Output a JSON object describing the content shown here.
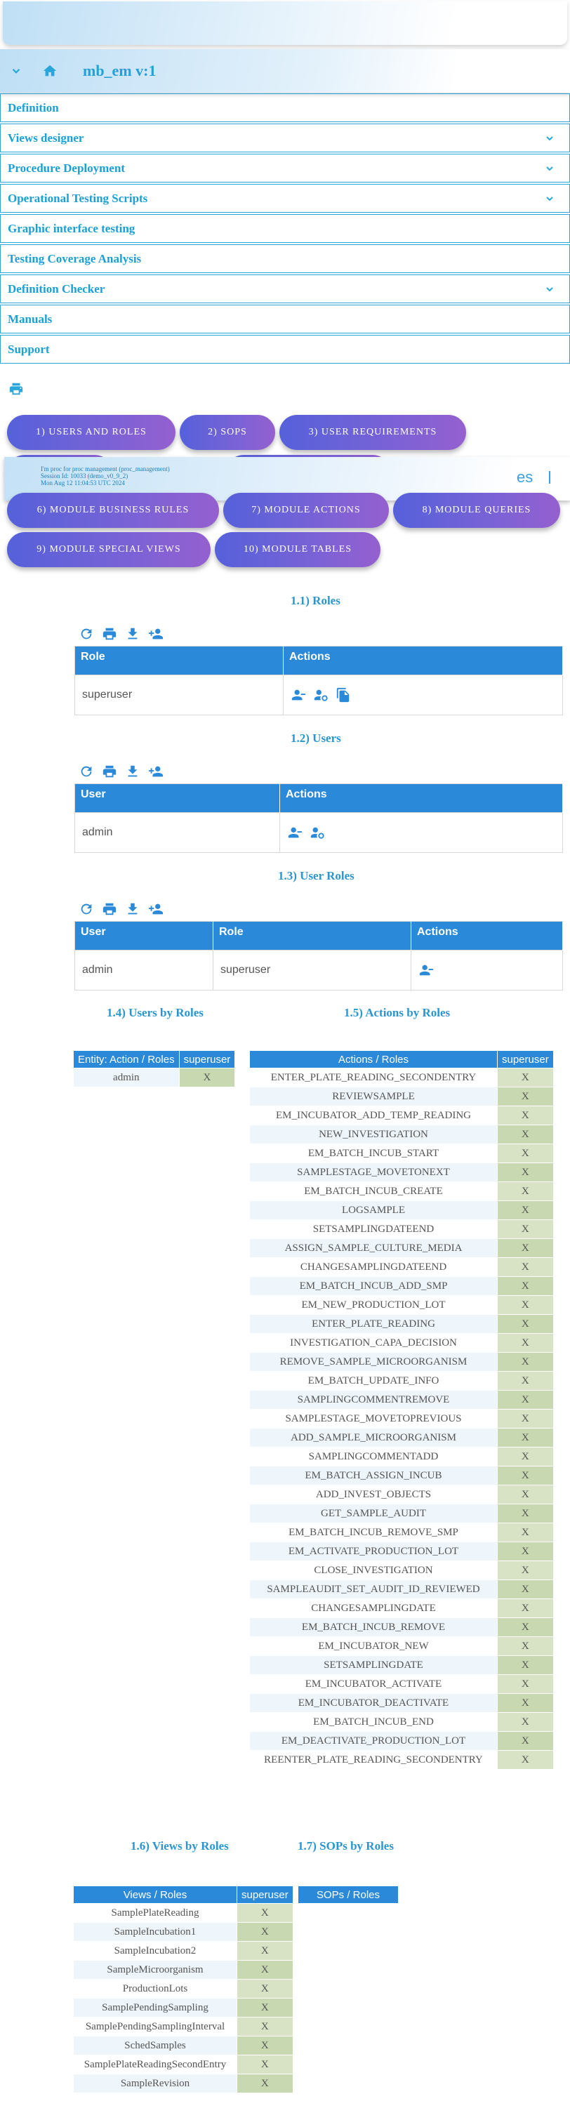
{
  "header": {
    "app_title": "mb_em v:1"
  },
  "menu": [
    {
      "label": "Definition",
      "chevron": false
    },
    {
      "label": "Views designer",
      "chevron": true
    },
    {
      "label": "Procedure Deployment",
      "chevron": true
    },
    {
      "label": "Operational Testing Scripts",
      "chevron": true
    },
    {
      "label": "Graphic interface testing",
      "chevron": false
    },
    {
      "label": "Testing Coverage Analysis",
      "chevron": false
    },
    {
      "label": "Definition Checker",
      "chevron": true
    },
    {
      "label": "Manuals",
      "chevron": false
    },
    {
      "label": "Support",
      "chevron": false
    }
  ],
  "tabs": [
    "1) USERS AND ROLES",
    "2) SOPS",
    "3) USER REQUIREMENTS",
    "6) MODULE BUSINESS RULES",
    "7) MODULE ACTIONS",
    "8) MODULE QUERIES",
    "9) MODULE SPECIAL VIEWS",
    "10) MODULE TABLES"
  ],
  "session": {
    "line1": "I'm proc for proc management (proc_management)",
    "line2": "Session Id: 10033 (demo_v0_9_2)",
    "line3": "Mon Aug 12 11:04:53 UTC 2024",
    "language": "es"
  },
  "sections": {
    "roles": "1.1) Roles",
    "users": "1.2) Users",
    "user_roles": "1.3) User Roles",
    "users_by_roles": "1.4) Users by Roles",
    "actions_by_roles": "1.5) Actions by Roles",
    "views_by_roles": "1.6) Views by Roles",
    "sops_by_roles": "1.7) SOPs by Roles"
  },
  "roles_table": {
    "headers": [
      "Role",
      "Actions"
    ],
    "rows": [
      [
        "superuser"
      ]
    ]
  },
  "users_table": {
    "headers": [
      "User",
      "Actions"
    ],
    "rows": [
      [
        "admin"
      ]
    ]
  },
  "user_roles_table": {
    "headers": [
      "User",
      "Role",
      "Actions"
    ],
    "rows": [
      [
        "admin",
        "superuser"
      ]
    ]
  },
  "users_by_roles": {
    "headers": [
      "Entity: Action / Roles",
      "superuser"
    ],
    "rows": [
      [
        "admin",
        "X"
      ]
    ]
  },
  "actions_by_roles": {
    "headers": [
      "Actions / Roles",
      "superuser"
    ],
    "rows": [
      "ENTER_PLATE_READING_SECONDENTRY",
      "REVIEWSAMPLE",
      "EM_INCUBATOR_ADD_TEMP_READING",
      "NEW_INVESTIGATION",
      "EM_BATCH_INCUB_START",
      "SAMPLESTAGE_MOVETONEXT",
      "EM_BATCH_INCUB_CREATE",
      "LOGSAMPLE",
      "SETSAMPLINGDATEEND",
      "ASSIGN_SAMPLE_CULTURE_MEDIA",
      "CHANGESAMPLINGDATEEND",
      "EM_BATCH_INCUB_ADD_SMP",
      "EM_NEW_PRODUCTION_LOT",
      "ENTER_PLATE_READING",
      "INVESTIGATION_CAPA_DECISION",
      "REMOVE_SAMPLE_MICROORGANISM",
      "EM_BATCH_UPDATE_INFO",
      "SAMPLINGCOMMENTREMOVE",
      "SAMPLESTAGE_MOVETOPREVIOUS",
      "ADD_SAMPLE_MICROORGANISM",
      "SAMPLINGCOMMENTADD",
      "EM_BATCH_ASSIGN_INCUB",
      "ADD_INVEST_OBJECTS",
      "GET_SAMPLE_AUDIT",
      "EM_BATCH_INCUB_REMOVE_SMP",
      "EM_ACTIVATE_PRODUCTION_LOT",
      "CLOSE_INVESTIGATION",
      "SAMPLEAUDIT_SET_AUDIT_ID_REVIEWED",
      "CHANGESAMPLINGDATE",
      "EM_BATCH_INCUB_REMOVE",
      "EM_INCUBATOR_NEW",
      "SETSAMPLINGDATE",
      "EM_INCUBATOR_ACTIVATE",
      "EM_INCUBATOR_DEACTIVATE",
      "EM_BATCH_INCUB_END",
      "EM_DEACTIVATE_PRODUCTION_LOT",
      "REENTER_PLATE_READING_SECONDENTRY"
    ],
    "mark": "X"
  },
  "views_by_roles": {
    "headers": [
      "Views / Roles",
      "superuser"
    ],
    "rows": [
      "SamplePlateReading",
      "SampleIncubation1",
      "SampleIncubation2",
      "SampleMicroorganism",
      "ProductionLots",
      "SamplePendingSampling",
      "SamplePendingSamplingInterval",
      "SchedSamples",
      "SamplePlateReadingSecondEntry",
      "SampleRevision"
    ],
    "mark": "X"
  },
  "sops_by_roles": {
    "headers": [
      "SOPs / Roles"
    ]
  },
  "colors": {
    "accent": "#2a89d8",
    "menu": "#1aa0d6",
    "mark_cell": "#d7e3c4"
  }
}
